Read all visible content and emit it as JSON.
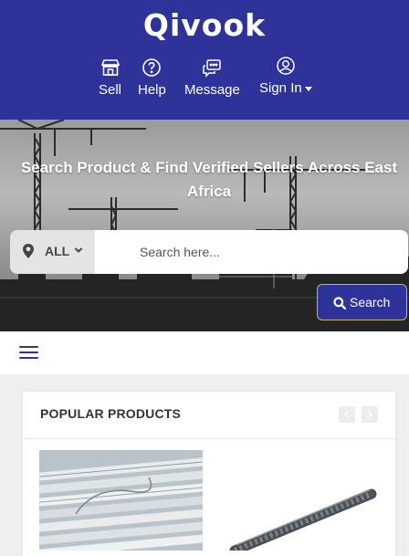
{
  "header": {
    "brand": "Qivook",
    "nav": [
      {
        "label": "Sell",
        "icon": "shop-icon"
      },
      {
        "label": "Help",
        "icon": "help-icon"
      },
      {
        "label": "Message",
        "icon": "message-icon"
      },
      {
        "label": "Sign In",
        "icon": "user-icon"
      }
    ],
    "bg_color": "#2e3399"
  },
  "hero": {
    "title": "Search Product & Find Verified Sellers Across East Africa",
    "location_label": "ALL",
    "search_placeholder": "Search here...",
    "search_button": "Search"
  },
  "popular": {
    "title": "POPULAR PRODUCTS",
    "products": [
      {
        "image": "steel-pipes-image"
      },
      {
        "image": "rebar-image"
      }
    ]
  }
}
